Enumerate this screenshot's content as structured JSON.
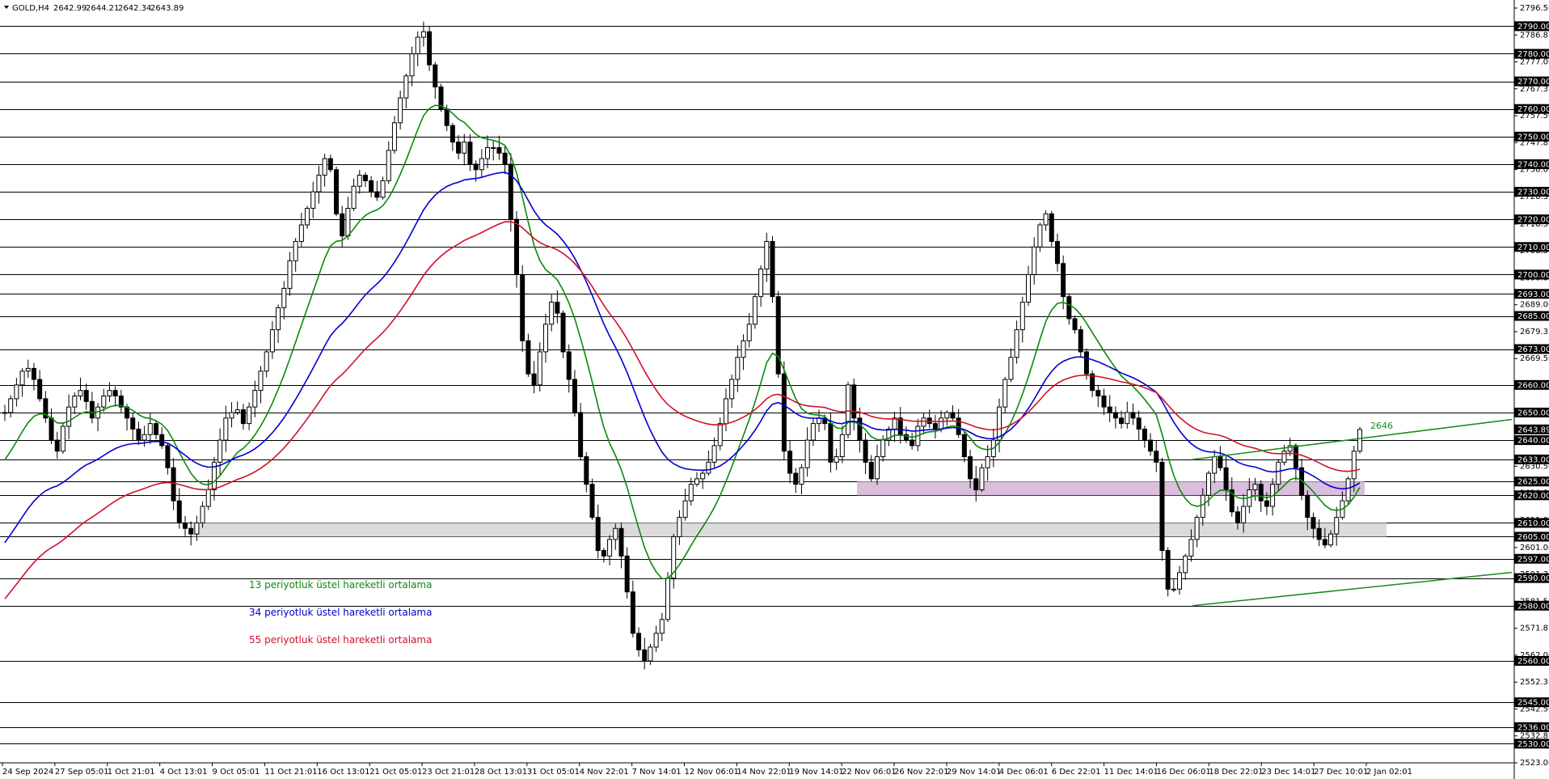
{
  "chart_data": {
    "type": "candlestick",
    "symbol": "GOLD,H4",
    "ohlc_text": [
      "2642.99",
      "2644.21",
      "2642.34",
      "2643.89"
    ],
    "ylim": [
      2523.06,
      2796.56
    ],
    "y_axis_ticks": [
      "2796.56",
      "2786.81",
      "2777.06",
      "2767.31",
      "2757.56",
      "2747.81",
      "2738.06",
      "2728.31",
      "2718.31",
      "2708.56",
      "2698.81",
      "2689.06",
      "2679.31",
      "2669.56",
      "2659.81",
      "2650.06",
      "2640.31",
      "2630.56",
      "2620.81",
      "2611.06",
      "2601.06",
      "2591.31",
      "2581.56",
      "2571.81",
      "2562.06",
      "2552.31",
      "2542.56",
      "2532.81",
      "2523.06"
    ],
    "horizontal_levels": [
      2790,
      2780,
      2770,
      2760,
      2750,
      2740,
      2730,
      2720,
      2710,
      2700,
      2693,
      2685,
      2673,
      2660,
      2650,
      2640,
      2633,
      2625,
      2620,
      2610,
      2605,
      2597,
      2590,
      2580,
      2560,
      2545,
      2536,
      2530
    ],
    "level_labels": [
      "2790.00",
      "2780.00",
      "2770.00",
      "2760.00",
      "2750.00",
      "2740.00",
      "2730.00",
      "2720.00",
      "2710.00",
      "2700.00",
      "2693.00",
      "2685.00",
      "2673.00",
      "2660.00",
      "2650.00",
      "2640.00",
      "2633.00",
      "2625.00",
      "2620.00",
      "2610.00",
      "2605.00",
      "2597.00",
      "2590.00",
      "2580.00",
      "2560.00",
      "2545.00",
      "2536.00",
      "2530.00"
    ],
    "current_price": {
      "value": 2643.89,
      "label": "2643.89"
    },
    "x_axis_labels": [
      "24 Sep 2024",
      "27 Sep 05:01",
      "1 Oct 21:01",
      "4 Oct 13:01",
      "9 Oct 05:01",
      "11 Oct 21:01",
      "16 Oct 13:01",
      "21 Oct 05:01",
      "23 Oct 21:01",
      "28 Oct 13:01",
      "31 Oct 05:01",
      "4 Nov 22:01",
      "7 Nov 14:01",
      "12 Nov 06:01",
      "14 Nov 22:01",
      "19 Nov 14:01",
      "22 Nov 06:01",
      "26 Nov 22:01",
      "29 Nov 14:01",
      "4 Dec 06:01",
      "6 Dec 22:01",
      "11 Dec 14:01",
      "16 Dec 06:01",
      "18 Dec 22:01",
      "23 Dec 14:01",
      "27 Dec 10:01",
      "2 Jan 02:01"
    ],
    "close_path": [
      2650,
      2655,
      2660,
      2665,
      2666,
      2662,
      2655,
      2648,
      2640,
      2636,
      2645,
      2652,
      2656,
      2658,
      2654,
      2648,
      2652,
      2656,
      2658,
      2656,
      2652,
      2648,
      2644,
      2640,
      2642,
      2646,
      2642,
      2638,
      2630,
      2618,
      2610,
      2608,
      2606,
      2610,
      2616,
      2622,
      2632,
      2640,
      2648,
      2650,
      2651,
      2646,
      2652,
      2658,
      2665,
      2672,
      2680,
      2688,
      2695,
      2705,
      2712,
      2718,
      2724,
      2730,
      2736,
      2742,
      2738,
      2722,
      2714,
      2724,
      2732,
      2736,
      2734,
      2730,
      2728,
      2734,
      2745,
      2755,
      2764,
      2772,
      2780,
      2786,
      2788,
      2776,
      2768,
      2760,
      2754,
      2748,
      2744,
      2748,
      2740,
      2738,
      2742,
      2746,
      2746,
      2744,
      2740,
      2720,
      2700,
      2676,
      2664,
      2660,
      2672,
      2682,
      2690,
      2686,
      2672,
      2662,
      2650,
      2634,
      2624,
      2612,
      2600,
      2598,
      2604,
      2608,
      2598,
      2585,
      2570,
      2564,
      2560,
      2565,
      2570,
      2575,
      2590,
      2605,
      2612,
      2618,
      2624,
      2626,
      2628,
      2632,
      2638,
      2646,
      2655,
      2662,
      2670,
      2676,
      2682,
      2692,
      2702,
      2712,
      2692,
      2664,
      2636,
      2628,
      2624,
      2630,
      2640,
      2646,
      2648,
      2646,
      2632,
      2634,
      2642,
      2660,
      2648,
      2640,
      2632,
      2626,
      2634,
      2640,
      2644,
      2648,
      2642,
      2640,
      2638,
      2645,
      2648,
      2646,
      2644,
      2648,
      2650,
      2648,
      2642,
      2634,
      2626,
      2622,
      2630,
      2634,
      2640,
      2652,
      2662,
      2670,
      2680,
      2690,
      2700,
      2710,
      2718,
      2722,
      2712,
      2704,
      2692,
      2684,
      2680,
      2672,
      2664,
      2658,
      2656,
      2652,
      2650,
      2648,
      2646,
      2650,
      2648,
      2644,
      2640,
      2636,
      2632,
      2600,
      2586,
      2586,
      2592,
      2598,
      2604,
      2612,
      2620,
      2628,
      2634,
      2630,
      2622,
      2614,
      2610,
      2616,
      2622,
      2624,
      2618,
      2616,
      2624,
      2632,
      2636,
      2638,
      2630,
      2620,
      2612,
      2608,
      2604,
      2602,
      2606,
      2612,
      2618,
      2626,
      2636,
      2643.89
    ],
    "ema_series": [
      {
        "name": "13 periyotluk üstel hareketli ortalama",
        "period": 13,
        "color": "#0a8a0a"
      },
      {
        "name": "34 periyotluk üstel hareketli ortalama",
        "period": 34,
        "color": "#0000d0"
      },
      {
        "name": "55 periyotluk üstel hareketli ortalama",
        "period": 55,
        "color": "#d0102a"
      }
    ],
    "zones": [
      {
        "name": "lower-support-zone",
        "y_from": 2605,
        "y_to": 2610,
        "color": "#d7d7d7"
      },
      {
        "name": "resistance-zone",
        "y_from": 2620,
        "y_to": 2625,
        "color": "#d6b8d8"
      }
    ],
    "channel": {
      "upper_start": {
        "x": "18 Dec 22:01",
        "y": 2633
      },
      "upper_slope_per_day": 1.2,
      "lower_start": {
        "x": "18 Dec 22:01",
        "y": 2580
      },
      "lower_slope_per_day": 1.0,
      "color": "#1a8a1a",
      "annotation": "2646"
    }
  }
}
